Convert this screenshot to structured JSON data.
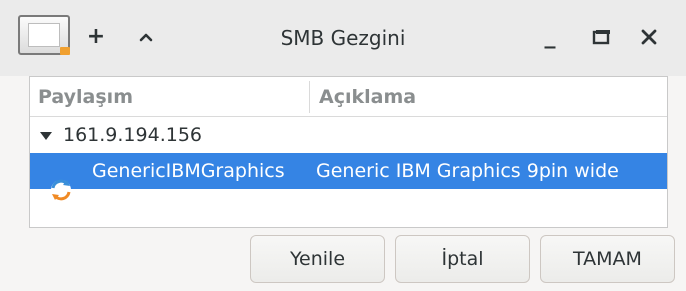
{
  "window": {
    "title": "SMB Gezgini",
    "titlebar_buttons": {
      "new": "+",
      "up": "^",
      "minimize": "_",
      "maximize": "□",
      "close": "✕"
    }
  },
  "list": {
    "columns": [
      "Paylaşım",
      "Açıklama"
    ],
    "host": "161.9.194.156",
    "shares": [
      {
        "name": "GenericIBMGraphics",
        "description": "Generic IBM Graphics 9pin wide",
        "icon": "printer-share-icon",
        "selected": true
      }
    ]
  },
  "buttons": {
    "refresh": "Yenile",
    "cancel": "İptal",
    "ok": "TAMAM"
  },
  "colors": {
    "selection": "#3584e4",
    "titlebar": "#ebebeb",
    "header_text": "#8a8e8f"
  }
}
